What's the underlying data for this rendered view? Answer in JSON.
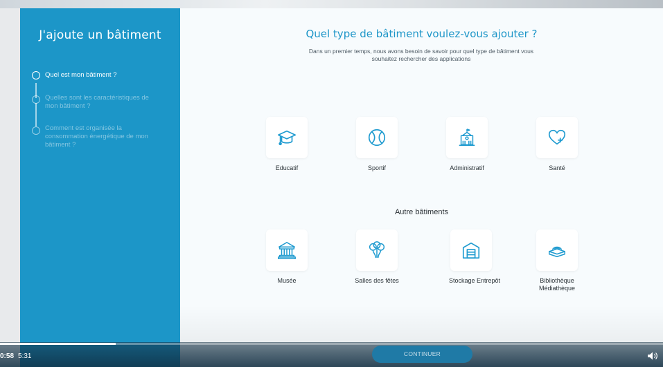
{
  "sidebar": {
    "title": "J'ajoute un bâtiment",
    "steps": [
      {
        "label": "Quel est mon bâtiment ?",
        "active": true
      },
      {
        "label": "Quelles sont les caractéristiques de mon bâtiment ?",
        "active": false
      },
      {
        "label": "Comment est organisée la consommation énergétique de mon bâtiment ?",
        "active": false
      }
    ]
  },
  "main": {
    "title": "Quel type de bâtiment voulez-vous ajouter ?",
    "subtitle": "Dans un premier temps, nous avons besoin de savoir pour quel type de bâtiment vous souhaitez rechercher des applications",
    "primary_types": [
      {
        "label": "Educatif",
        "icon": "graduation-cap-icon"
      },
      {
        "label": "Sportif",
        "icon": "tennis-ball-icon"
      },
      {
        "label": "Administratif",
        "icon": "town-hall-icon"
      },
      {
        "label": "Santé",
        "icon": "heart-plus-icon"
      }
    ],
    "other_heading": "Autre bâtiments",
    "other_types": [
      {
        "label": "Musée",
        "icon": "museum-icon"
      },
      {
        "label": "Salles des fêtes",
        "icon": "balloons-icon"
      },
      {
        "label": "Stockage Entrepôt",
        "icon": "warehouse-icon"
      },
      {
        "label": "Bibliothèque Médiathèque",
        "icon": "books-icon"
      }
    ],
    "continue_label": "CONTINUER"
  },
  "player": {
    "current_time": "0:58",
    "duration": "5:31",
    "progress_fraction": 0.175
  },
  "colors": {
    "sidebar": "#1c96c8",
    "accent": "#1e96c8",
    "icon": "#1f9bd0"
  }
}
